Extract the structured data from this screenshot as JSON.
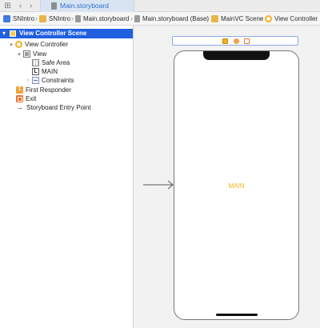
{
  "tab": {
    "label": "Main.storyboard"
  },
  "breadcrumb": [
    {
      "label": "SNIntro",
      "icon": "project-icon"
    },
    {
      "label": "SNIntro",
      "icon": "folder-icon"
    },
    {
      "label": "Main.storyboard",
      "icon": "storyboard-file-icon"
    },
    {
      "label": "Main.storyboard (Base)",
      "icon": "storyboard-file-icon"
    },
    {
      "label": "MainVC Scene",
      "icon": "folder-icon"
    },
    {
      "label": "View Controller",
      "icon": "view-controller-icon"
    }
  ],
  "outline": {
    "scene": "View Controller Scene",
    "items": [
      {
        "label": "View Controller",
        "icon": "view-controller-icon"
      },
      {
        "label": "View",
        "icon": "view-icon"
      },
      {
        "label": "Safe Area",
        "icon": "safe-area-icon"
      },
      {
        "label": "MAIN",
        "icon": "label-icon",
        "icon_text": "L"
      },
      {
        "label": "Constraints",
        "icon": "constraints-icon"
      },
      {
        "label": "First Responder",
        "icon": "first-responder-icon"
      },
      {
        "label": "Exit",
        "icon": "exit-icon"
      },
      {
        "label": "Storyboard Entry Point",
        "icon": "arrow-right-icon"
      }
    ]
  },
  "canvas": {
    "main_label": "MAIN"
  },
  "colors": {
    "selection": "#1f5fe0",
    "accent_yellow": "#f2b21c",
    "tab_highlight": "#d9e4f3"
  }
}
